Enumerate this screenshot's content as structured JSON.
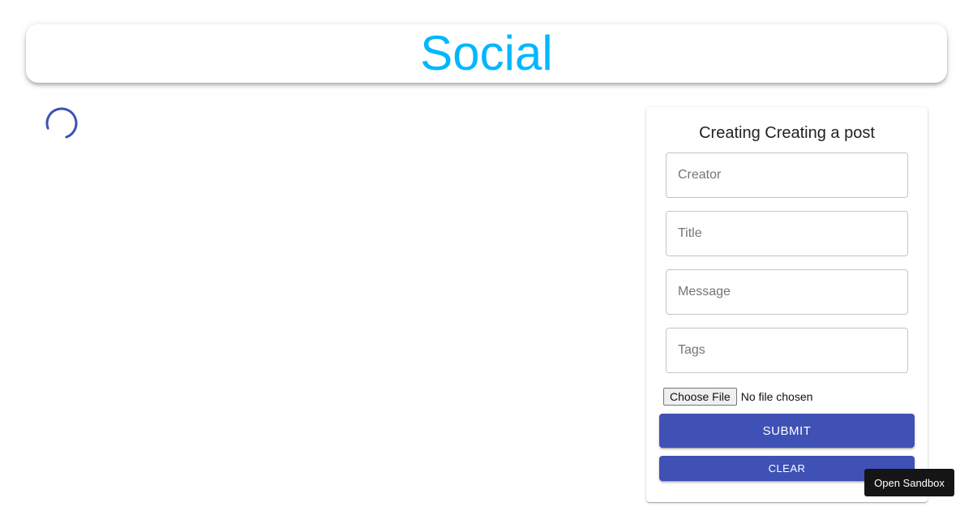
{
  "header": {
    "title": "Social"
  },
  "loading": {
    "icon": "loading-spinner-icon",
    "color": "#3f51b5"
  },
  "form": {
    "title": "Creating Creating a post",
    "fields": {
      "creator": {
        "placeholder": "Creator",
        "value": ""
      },
      "title": {
        "placeholder": "Title",
        "value": ""
      },
      "message": {
        "placeholder": "Message",
        "value": ""
      },
      "tags": {
        "placeholder": "Tags",
        "value": ""
      }
    },
    "file": {
      "button_label": "Choose File",
      "status": "No file chosen"
    },
    "submit_label": "SUBMIT",
    "clear_label": "CLEAR"
  },
  "sandbox": {
    "label": "Open Sandbox"
  },
  "colors": {
    "brand": "#00b7ff",
    "primary": "#3f51b5"
  }
}
